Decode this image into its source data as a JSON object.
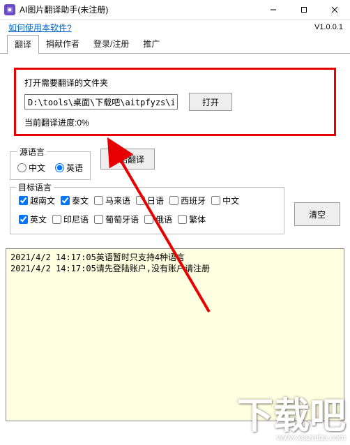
{
  "titlebar": {
    "title": "AI图片翻译助手(未注册)"
  },
  "topstrip": {
    "help": "如何使用本软件?",
    "version": "V1.0.0.1"
  },
  "tabs": {
    "items": [
      "翻译",
      "捐献作者",
      "登录/注册",
      "推广"
    ],
    "active": 0
  },
  "folder": {
    "label": "打开需要翻译的文件夹",
    "path": "D:\\tools\\桌面\\下载吧\\aitpfyzs\\im",
    "open_btn": "打开",
    "progress_label": "当前翻译进度:",
    "progress_value": "0%"
  },
  "source": {
    "legend": "源语言",
    "options": [
      "中文",
      "英语"
    ],
    "selected": 1
  },
  "start_btn": "开始翻译",
  "target": {
    "legend": "目标语言",
    "row1": [
      {
        "label": "越南文",
        "checked": true
      },
      {
        "label": "泰文",
        "checked": true
      },
      {
        "label": "马来语",
        "checked": false
      },
      {
        "label": "日语",
        "checked": false
      },
      {
        "label": "西班牙",
        "checked": false
      },
      {
        "label": "中文",
        "checked": false
      }
    ],
    "row2": [
      {
        "label": "英文",
        "checked": true
      },
      {
        "label": "印尼语",
        "checked": false
      },
      {
        "label": "葡萄牙语",
        "checked": false
      },
      {
        "label": "俄语",
        "checked": false
      },
      {
        "label": "繁体",
        "checked": false
      }
    ]
  },
  "clear_btn": "清空",
  "log": {
    "lines": [
      "2021/4/2 14:17:05英语暂时只支持4种语言",
      "2021/4/2 14:17:05请先登陆账户,没有账户请注册"
    ]
  },
  "watermark": {
    "big": "下载吧",
    "small": "www.xiazaiba.com"
  },
  "colors": {
    "highlight": "#e60000",
    "logbg": "#ffffe1"
  }
}
